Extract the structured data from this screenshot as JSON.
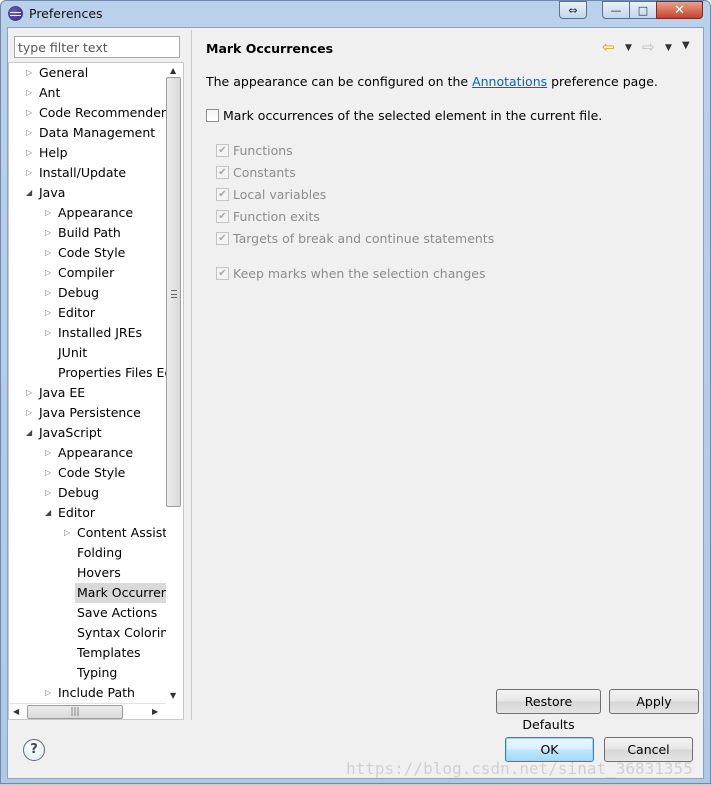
{
  "window": {
    "title": "Preferences",
    "restore_glyph": "⇔",
    "min_glyph": "—",
    "max_glyph": "□",
    "close_glyph": "✕"
  },
  "filter": {
    "placeholder": "type filter text",
    "value": ""
  },
  "tree": {
    "selected_index": 26,
    "items": [
      {
        "label": "General",
        "level": 0,
        "state": "collapsed"
      },
      {
        "label": "Ant",
        "level": 0,
        "state": "collapsed"
      },
      {
        "label": "Code Recommenders",
        "level": 0,
        "state": "collapsed"
      },
      {
        "label": "Data Management",
        "level": 0,
        "state": "collapsed"
      },
      {
        "label": "Help",
        "level": 0,
        "state": "collapsed"
      },
      {
        "label": "Install/Update",
        "level": 0,
        "state": "collapsed"
      },
      {
        "label": "Java",
        "level": 0,
        "state": "expanded"
      },
      {
        "label": "Appearance",
        "level": 1,
        "state": "collapsed"
      },
      {
        "label": "Build Path",
        "level": 1,
        "state": "collapsed"
      },
      {
        "label": "Code Style",
        "level": 1,
        "state": "collapsed"
      },
      {
        "label": "Compiler",
        "level": 1,
        "state": "collapsed"
      },
      {
        "label": "Debug",
        "level": 1,
        "state": "collapsed"
      },
      {
        "label": "Editor",
        "level": 1,
        "state": "collapsed"
      },
      {
        "label": "Installed JREs",
        "level": 1,
        "state": "collapsed"
      },
      {
        "label": "JUnit",
        "level": 1,
        "state": "leaf"
      },
      {
        "label": "Properties Files Ed",
        "level": 1,
        "state": "leaf"
      },
      {
        "label": "Java EE",
        "level": 0,
        "state": "collapsed"
      },
      {
        "label": "Java Persistence",
        "level": 0,
        "state": "collapsed"
      },
      {
        "label": "JavaScript",
        "level": 0,
        "state": "expanded"
      },
      {
        "label": "Appearance",
        "level": 1,
        "state": "collapsed"
      },
      {
        "label": "Code Style",
        "level": 1,
        "state": "collapsed"
      },
      {
        "label": "Debug",
        "level": 1,
        "state": "collapsed"
      },
      {
        "label": "Editor",
        "level": 1,
        "state": "expanded"
      },
      {
        "label": "Content Assist",
        "level": 2,
        "state": "collapsed"
      },
      {
        "label": "Folding",
        "level": 2,
        "state": "leaf"
      },
      {
        "label": "Hovers",
        "level": 2,
        "state": "leaf"
      },
      {
        "label": "Mark Occurren",
        "level": 2,
        "state": "leaf"
      },
      {
        "label": "Save Actions",
        "level": 2,
        "state": "leaf"
      },
      {
        "label": "Syntax Coloring",
        "level": 2,
        "state": "leaf"
      },
      {
        "label": "Templates",
        "level": 2,
        "state": "leaf"
      },
      {
        "label": "Typing",
        "level": 2,
        "state": "leaf"
      },
      {
        "label": "Include Path",
        "level": 1,
        "state": "collapsed"
      }
    ]
  },
  "page": {
    "title": "Mark Occurrences",
    "description_before": "The appearance can be configured on the ",
    "description_link": "Annotations",
    "description_after": " preference page.",
    "main_option": {
      "label": "Mark occurrences of the selected element in the current file.",
      "checked": false
    },
    "sub_options": [
      {
        "label": "Functions",
        "checked": true,
        "enabled": false
      },
      {
        "label": "Constants",
        "checked": true,
        "enabled": false
      },
      {
        "label": "Local variables",
        "checked": true,
        "enabled": false
      },
      {
        "label": "Function exits",
        "checked": true,
        "enabled": false
      },
      {
        "label": "Targets of break and continue statements",
        "checked": true,
        "enabled": false
      }
    ],
    "keep_marks": {
      "label": "Keep marks when the selection changes",
      "checked": true,
      "enabled": false
    }
  },
  "nav": {
    "back_glyph": "⇦",
    "forward_glyph": "⇨",
    "dropdown_glyph": "▼",
    "back_color": "#d8a000",
    "forward_color": "#bbbbbb"
  },
  "buttons": {
    "restore_defaults": "Restore Defaults",
    "apply": "Apply",
    "ok": "OK",
    "cancel": "Cancel",
    "help_glyph": "?"
  },
  "watermark": "https://blog.csdn.net/sinat_36831355"
}
